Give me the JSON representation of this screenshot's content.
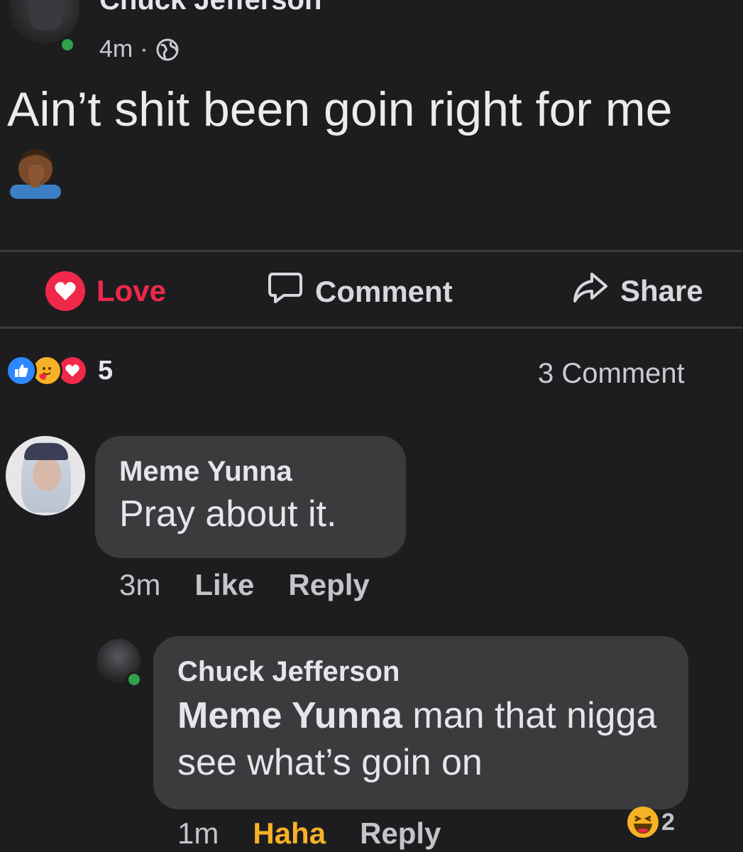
{
  "post": {
    "author": "Chuck Jefferson",
    "time": "4m",
    "separator": "·",
    "privacy_icon": "globe-icon",
    "text": "Ain’t shit been goin right for me",
    "emoji": "person-facepalming-medium-dark"
  },
  "actions": {
    "love_label": "Love",
    "comment_label": "Comment",
    "share_label": "Share"
  },
  "summary": {
    "reaction_icons": [
      "like-icon",
      "care-icon",
      "love-icon"
    ],
    "reaction_count": "5",
    "comment_count": "3 Comment"
  },
  "comments": [
    {
      "author": "Meme Yunna",
      "text": "Pray about it.",
      "time": "3m",
      "like_label": "Like",
      "reply_label": "Reply"
    },
    {
      "author": "Chuck Jefferson",
      "mention": "Meme Yunna",
      "text": " man that nigga see what’s goin on",
      "time": "1m",
      "reaction_label": "Haha",
      "reply_label": "Reply",
      "reaction_icon": "haha-icon",
      "reaction_count": "2"
    }
  ],
  "colors": {
    "background": "#1d1d1f",
    "bubble": "#3a3b3c",
    "love": "#f0284a",
    "like": "#2d88ff",
    "haha": "#f7b125",
    "online": "#31a24c"
  }
}
